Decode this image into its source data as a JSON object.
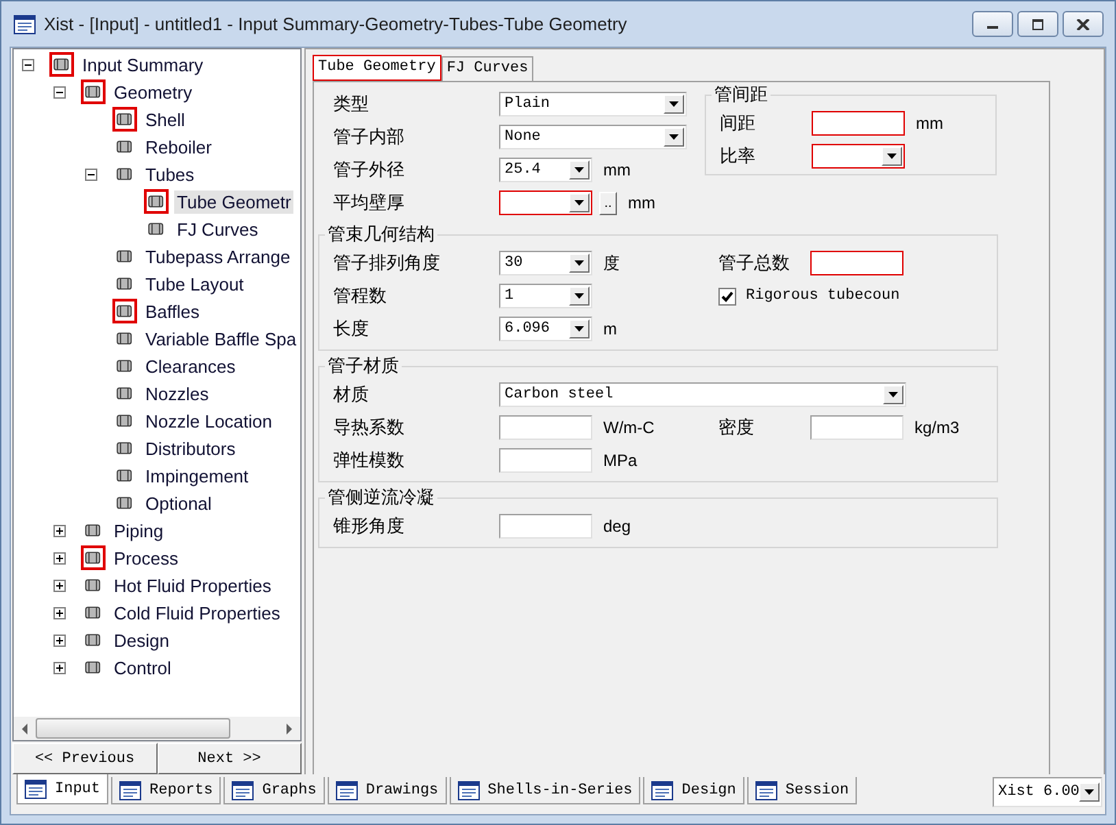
{
  "window": {
    "title": "Xist - [Input] - untitled1 - Input Summary-Geometry-Tubes-Tube Geometry"
  },
  "tree": [
    {
      "label": "Input Summary",
      "flagged": true,
      "selected": false,
      "expanded": true,
      "children": [
        {
          "label": "Geometry",
          "flagged": true,
          "selected": false,
          "expanded": true,
          "children": [
            {
              "label": "Shell",
              "flagged": true,
              "selected": false
            },
            {
              "label": "Reboiler",
              "flagged": false,
              "selected": false
            },
            {
              "label": "Tubes",
              "flagged": false,
              "selected": false,
              "expanded": true,
              "children": [
                {
                  "label": "Tube Geometr",
                  "flagged": true,
                  "selected": true
                },
                {
                  "label": "FJ Curves",
                  "flagged": false,
                  "selected": false
                }
              ]
            },
            {
              "label": "Tubepass Arrange",
              "flagged": false,
              "selected": false
            },
            {
              "label": "Tube Layout",
              "flagged": false,
              "selected": false
            },
            {
              "label": "Baffles",
              "flagged": true,
              "selected": false
            },
            {
              "label": "Variable Baffle Spa",
              "flagged": false,
              "selected": false
            },
            {
              "label": "Clearances",
              "flagged": false,
              "selected": false
            },
            {
              "label": "Nozzles",
              "flagged": false,
              "selected": false
            },
            {
              "label": "Nozzle Location",
              "flagged": false,
              "selected": false
            },
            {
              "label": "Distributors",
              "flagged": false,
              "selected": false
            },
            {
              "label": "Impingement",
              "flagged": false,
              "selected": false
            },
            {
              "label": "Optional",
              "flagged": false,
              "selected": false
            }
          ]
        },
        {
          "label": "Piping",
          "flagged": false,
          "selected": false,
          "expanded": false
        },
        {
          "label": "Process",
          "flagged": true,
          "selected": false,
          "expanded": false
        },
        {
          "label": "Hot Fluid Properties",
          "flagged": false,
          "selected": false,
          "expanded": false
        },
        {
          "label": "Cold Fluid Properties",
          "flagged": false,
          "selected": false,
          "expanded": false
        },
        {
          "label": "Design",
          "flagged": false,
          "selected": false,
          "expanded": false
        },
        {
          "label": "Control",
          "flagged": false,
          "selected": false,
          "expanded": false
        }
      ]
    }
  ],
  "nav_buttons": [
    "<< Previous",
    "Next >>"
  ],
  "panel_tabs": [
    {
      "label": "Tube Geometry",
      "selected": true
    },
    {
      "label": "FJ Curves",
      "selected": false
    }
  ],
  "form": {
    "top": {
      "fields": [
        {
          "label": "类型",
          "kind": "combo",
          "value": "Plain",
          "required": false
        },
        {
          "label": "管子内部",
          "kind": "combo",
          "value": "None",
          "required": false
        },
        {
          "label": "管子外径",
          "kind": "combo",
          "value": "25.4",
          "unit": "mm",
          "required": false
        },
        {
          "label": "平均壁厚",
          "kind": "combo",
          "required": true,
          "button": "..",
          "unit": "mm"
        }
      ],
      "spacing": {
        "title": "管间距",
        "fields": [
          {
            "label": "间距",
            "kind": "text",
            "required": true,
            "unit": "mm"
          },
          {
            "label": "比率",
            "kind": "combo",
            "required": true
          }
        ]
      }
    },
    "groups": [
      {
        "title": "管束几何结构",
        "rows": [
          [
            {
              "label": "管子排列角度",
              "kind": "combo",
              "value": "30",
              "unit": "度",
              "required": false
            },
            {
              "label": "管子总数",
              "kind": "text",
              "required": true
            }
          ],
          [
            {
              "label": "管程数",
              "kind": "combo",
              "value": "1",
              "required": false
            },
            {
              "label": "Rigorous tubecoun",
              "kind": "checkbox",
              "checked": true
            }
          ],
          [
            {
              "label": "长度",
              "kind": "combo",
              "value": "6.096",
              "unit": "m",
              "required": false
            }
          ]
        ]
      },
      {
        "title": "管子材质",
        "rows": [
          [
            {
              "label": "材质",
              "kind": "combo",
              "value": "Carbon steel",
              "required": false
            }
          ],
          [
            {
              "label": "导热系数",
              "kind": "text",
              "unit": "W/m-C",
              "required": false
            },
            {
              "label": "密度",
              "kind": "text",
              "unit": "kg/m3",
              "required": false
            }
          ],
          [
            {
              "label": "弹性模数",
              "kind": "text",
              "unit": "MPa",
              "required": false
            }
          ]
        ]
      },
      {
        "title": "管侧逆流冷凝",
        "rows": [
          [
            {
              "label": "锥形角度",
              "kind": "text",
              "unit": "deg",
              "required": false
            }
          ]
        ]
      }
    ]
  },
  "bottom_tabs": [
    {
      "label": "Input",
      "selected": true
    },
    {
      "label": "Reports",
      "selected": false
    },
    {
      "label": "Graphs",
      "selected": false
    },
    {
      "label": "Drawings",
      "selected": false
    },
    {
      "label": "Shells-in-Series",
      "selected": false
    },
    {
      "label": "Design",
      "selected": false
    },
    {
      "label": "Session",
      "selected": false
    }
  ],
  "version": "Xist 6.00"
}
